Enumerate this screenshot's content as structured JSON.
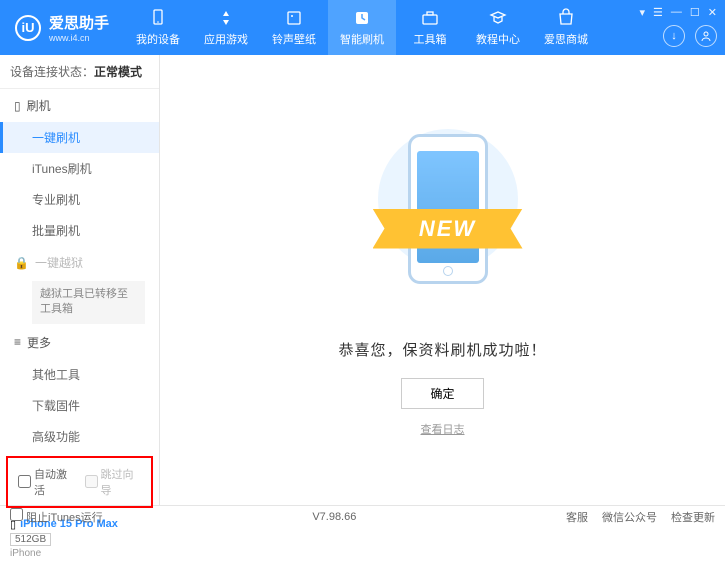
{
  "header": {
    "logo_text": "爱思助手",
    "logo_sub": "www.i4.cn",
    "tabs": [
      {
        "label": "我的设备"
      },
      {
        "label": "应用游戏"
      },
      {
        "label": "铃声壁纸"
      },
      {
        "label": "智能刷机"
      },
      {
        "label": "工具箱"
      },
      {
        "label": "教程中心"
      },
      {
        "label": "爱思商城"
      }
    ]
  },
  "status": {
    "label": "设备连接状态：",
    "value": "正常模式"
  },
  "sidebar": {
    "group_flash": "刷机",
    "items_flash": [
      "一键刷机",
      "iTunes刷机",
      "专业刷机",
      "批量刷机"
    ],
    "group_jailbreak": "一键越狱",
    "jailbreak_note": "越狱工具已转移至工具箱",
    "group_more": "更多",
    "items_more": [
      "其他工具",
      "下载固件",
      "高级功能"
    ],
    "checkbox_auto": "自动激活",
    "checkbox_skip": "跳过向导"
  },
  "device": {
    "name": "iPhone 15 Pro Max",
    "storage": "512GB",
    "type": "iPhone"
  },
  "main": {
    "ribbon": "NEW",
    "success": "恭喜您，保资料刷机成功啦！",
    "ok": "确定",
    "log": "查看日志"
  },
  "footer": {
    "block_itunes": "阻止iTunes运行",
    "version": "V7.98.66",
    "links": [
      "客服",
      "微信公众号",
      "检查更新"
    ]
  }
}
